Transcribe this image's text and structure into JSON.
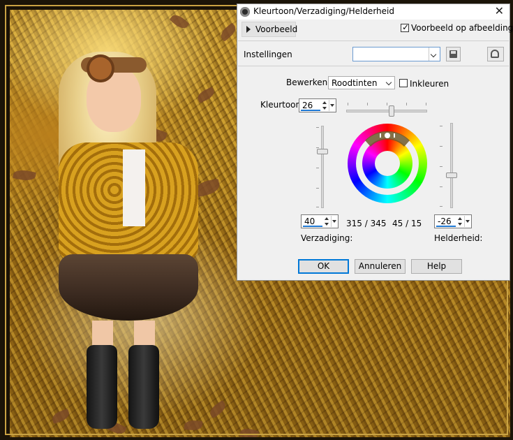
{
  "dialog": {
    "title": "Kleurtoon/Verzadiging/Helderheid",
    "close_glyph": "✕",
    "preview_toggle_label": "Voorbeeld",
    "preview_on_image": {
      "label": "Voorbeeld op afbeelding",
      "checked": true
    },
    "settings_label": "Instellingen",
    "settings_value": "",
    "edit_label": "Bewerken:",
    "edit_value": "Roodtinten",
    "colorize": {
      "label": "Inkleuren",
      "checked": false
    },
    "hue": {
      "label": "Kleurtoon:",
      "value": "26"
    },
    "saturation": {
      "label": "Verzadiging:",
      "value": "40"
    },
    "lightness": {
      "label": "Helderheid:",
      "value": "-26"
    },
    "range_outer": "315 / 345",
    "range_inner": "45 / 15",
    "buttons": {
      "ok": "OK",
      "cancel": "Annuleren",
      "help": "Help"
    },
    "icons": {
      "save": "save-icon",
      "reset": "reset-icon",
      "app": "app-icon"
    },
    "accent_color": "#0078d7"
  }
}
